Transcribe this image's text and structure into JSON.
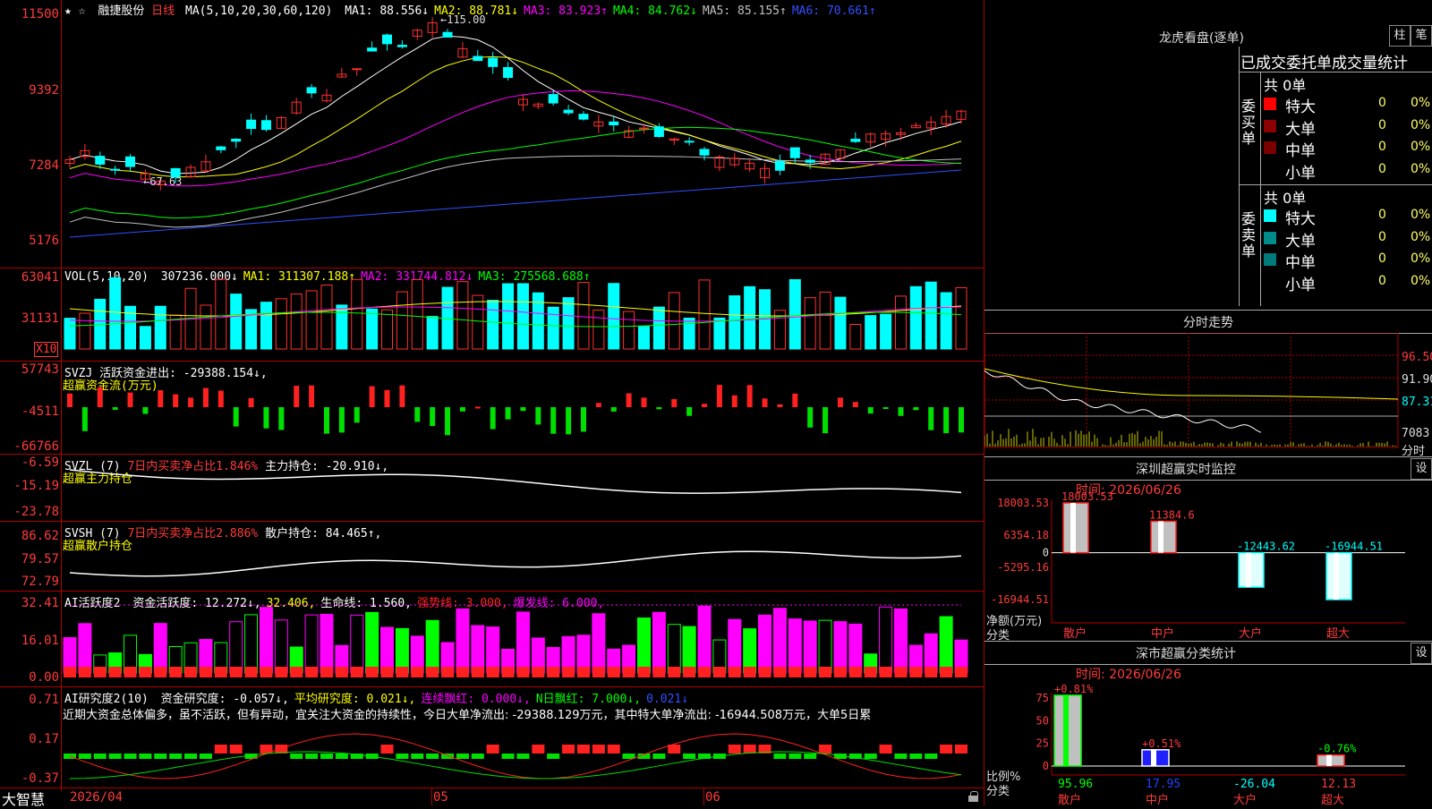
{
  "main": {
    "stars": "★ ☆",
    "stock_name": "融捷股份",
    "period": "日线",
    "ma_header": "MA(5,10,20,30,60,120)",
    "ma_values": [
      {
        "text": "MA1: 88.556↓",
        "color": "#ffffff"
      },
      {
        "text": "MA2: 88.781↓",
        "color": "#ffff00"
      },
      {
        "text": "MA3: 83.923↑",
        "color": "#ff00ff"
      },
      {
        "text": "MA4: 84.762↓",
        "color": "#00ff00"
      },
      {
        "text": "MA5: 85.155↑",
        "color": "#c0c0c0"
      },
      {
        "text": "MA6: 70.661↑",
        "color": "#3050ff"
      }
    ],
    "y_ticks": [
      "11500",
      "9392",
      "7284",
      "5176"
    ],
    "high_label": "115.00",
    "low_label": "67.63"
  },
  "vol": {
    "header": "VOL(5,10,20)",
    "values": [
      {
        "text": "307236.000↓",
        "color": "#ffffff"
      },
      {
        "text": "MA1: 311307.188↑",
        "color": "#ffff00"
      },
      {
        "text": "MA2: 331744.812↓",
        "color": "#ff00ff"
      },
      {
        "text": "MA3: 275568.688↑",
        "color": "#00ff00"
      }
    ],
    "y_ticks": [
      "63041",
      "31131"
    ],
    "unit": "X10"
  },
  "svzj": {
    "header": "SVZJ  活跃资金进出: -29388.154↓,",
    "subtitle": "超赢资金流(万元)",
    "y_ticks": [
      "57743",
      "-4511",
      "-66766"
    ]
  },
  "svzl": {
    "name": "SVZL  (7)",
    "ratio": "7日内买卖净占比1.846%",
    "holding": "主力持仓: -20.910↓,",
    "subtitle": "超赢主力持仓",
    "y_ticks": [
      "-6.59",
      "-15.19",
      "-23.78"
    ]
  },
  "svsh": {
    "name": "SVSH  (7)",
    "ratio": "7日内买卖净占比2.886%",
    "holding": "散户持仓: 84.465↑,",
    "subtitle": "超赢散户持仓",
    "y_ticks": [
      "86.62",
      "79.57",
      "72.79"
    ]
  },
  "ai_active": {
    "header": "AI活跃度2",
    "values": [
      {
        "text": "资金活跃度: 12.272↓,",
        "color": "#ffffff"
      },
      {
        "text": "32.406,",
        "color": "#ffff00"
      },
      {
        "text": "生命线: 1.560,",
        "color": "#ffffff"
      },
      {
        "text": "强势线: 3.000,",
        "color": "#ff2020"
      },
      {
        "text": "爆发线: 6.000,",
        "color": "#ff00ff"
      }
    ],
    "y_ticks": [
      "32.41",
      "16.01",
      "0.00"
    ]
  },
  "ai_research": {
    "header": "AI研究度2(10)",
    "values": [
      {
        "text": "资金研究度: -0.057↓,",
        "color": "#ffffff"
      },
      {
        "text": "平均研究度: 0.021↓,",
        "color": "#ffff00"
      },
      {
        "text": "连续飘红: 0.000↓,",
        "color": "#ff00ff"
      },
      {
        "text": "N日飘红: 7.000↓,",
        "color": "#00ff00"
      },
      {
        "text": "0.021↓",
        "color": "#3050ff"
      }
    ],
    "comment": "近期大资金总体偏多，虽不活跃，但有异动，宜关注大资金的持续性，今日大单净流出: -29388.129万元，其中特大单净流出: -16944.508万元，大单5日累",
    "y_ticks": [
      "0.71",
      "0.17",
      "-0.37"
    ]
  },
  "xaxis": {
    "brand": "大智慧",
    "ticks": [
      "2026/04",
      "05",
      "06"
    ]
  },
  "lhb": {
    "title": "龙虎看盘(逐单)",
    "btn_zhu": "柱",
    "btn_bi": "笔",
    "heading": "已成交委托单成交量统计",
    "buy_label": "委买单",
    "sell_label": "委卖单",
    "buy_total": "共 0单",
    "sell_total": "共 0单",
    "buy_rows": [
      {
        "name": "特大",
        "count": "0",
        "pct": "0%",
        "color": "#ff0000"
      },
      {
        "name": "大单",
        "count": "0",
        "pct": "0%",
        "color": "#8b0000"
      },
      {
        "name": "中单",
        "count": "0",
        "pct": "0%",
        "color": "#7a0000"
      },
      {
        "name": "小单",
        "count": "0",
        "pct": "0%",
        "color": ""
      }
    ],
    "sell_rows": [
      {
        "name": "特大",
        "count": "0",
        "pct": "0%",
        "color": "#00ffff"
      },
      {
        "name": "大单",
        "count": "0",
        "pct": "0%",
        "color": "#008b8b"
      },
      {
        "name": "中单",
        "count": "0",
        "pct": "0%",
        "color": "#007a7a"
      },
      {
        "name": "小单",
        "count": "0",
        "pct": "0%",
        "color": ""
      }
    ]
  },
  "fenshi": {
    "title": "分时走势",
    "y_ticks": [
      "96.50",
      "91.90",
      "87.31"
    ],
    "vol_tick": "7083",
    "vol_label": "分时"
  },
  "sz_monitor": {
    "title": "深圳超赢实时监控",
    "settings": "设",
    "time": "时间: 2026/06/26",
    "y_ticks": [
      "18003.53",
      "6354.18",
      "-5295.16",
      "-16944.51"
    ],
    "y_zero": "0",
    "unit": "净额(万元)",
    "cat_label": "分类",
    "bars": [
      {
        "category": "散户",
        "value": 18003.53,
        "label": "18003.53"
      },
      {
        "category": "中户",
        "value": 11384.6,
        "label": "11384.6"
      },
      {
        "category": "大户",
        "value": -12443.62,
        "label": "-12443.62"
      },
      {
        "category": "超大",
        "value": -16944.51,
        "label": "-16944.51"
      }
    ]
  },
  "sz_class": {
    "title": "深市超赢分类统计",
    "settings": "设",
    "time": "时间: 2026/06/26",
    "y_ticks": [
      "75",
      "50",
      "25",
      "0"
    ],
    "unit": "比例%",
    "cat_label": "分类",
    "bars": [
      {
        "category": "散户",
        "top": "+0.81%",
        "bottom": "95.96"
      },
      {
        "category": "中户",
        "top": "+0.51%",
        "bottom": "17.95"
      },
      {
        "category": "大户",
        "top": "",
        "bottom": "-26.04"
      },
      {
        "category": "超大",
        "top": "-0.76%",
        "bottom": "12.13"
      }
    ]
  },
  "chart_data": [
    {
      "type": "bar",
      "title": "深圳超赢实时监控",
      "ylabel": "净额(万元)",
      "categories": [
        "散户",
        "中户",
        "大户",
        "超大"
      ],
      "values": [
        18003.53,
        11384.6,
        -12443.62,
        -16944.51
      ],
      "ylim": [
        -16944.51,
        18003.53
      ]
    },
    {
      "type": "bar",
      "title": "深市超赢分类统计",
      "ylabel": "比例%",
      "categories": [
        "散户",
        "中户",
        "大户",
        "超大"
      ],
      "values": [
        95.96,
        17.95,
        -26.04,
        12.13
      ],
      "ylim": [
        0,
        75
      ]
    }
  ]
}
